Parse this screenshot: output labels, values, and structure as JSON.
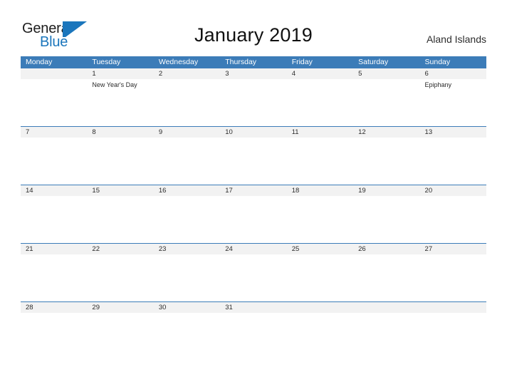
{
  "brand": {
    "name_primary": "General",
    "name_secondary": "Blue",
    "mark_icon": "blue-flag-triangle-icon",
    "primary_color": "#1d1d1d",
    "accent_color": "#1b76bc"
  },
  "header": {
    "title": "January 2019",
    "locale": "Aland Islands"
  },
  "theme": {
    "header_blue": "#3c7cb8",
    "date_strip_gray": "#f2f2f2",
    "text_color": "#2b2b2b",
    "background": "#ffffff"
  },
  "calendar": {
    "month": "January",
    "year": "2019",
    "weekday_headers": [
      "Monday",
      "Tuesday",
      "Wednesday",
      "Thursday",
      "Friday",
      "Saturday",
      "Sunday"
    ],
    "weeks": [
      {
        "days": [
          {
            "num": "",
            "event": ""
          },
          {
            "num": "1",
            "event": "New Year's Day"
          },
          {
            "num": "2",
            "event": ""
          },
          {
            "num": "3",
            "event": ""
          },
          {
            "num": "4",
            "event": ""
          },
          {
            "num": "5",
            "event": ""
          },
          {
            "num": "6",
            "event": "Epiphany"
          }
        ]
      },
      {
        "days": [
          {
            "num": "7",
            "event": ""
          },
          {
            "num": "8",
            "event": ""
          },
          {
            "num": "9",
            "event": ""
          },
          {
            "num": "10",
            "event": ""
          },
          {
            "num": "11",
            "event": ""
          },
          {
            "num": "12",
            "event": ""
          },
          {
            "num": "13",
            "event": ""
          }
        ]
      },
      {
        "days": [
          {
            "num": "14",
            "event": ""
          },
          {
            "num": "15",
            "event": ""
          },
          {
            "num": "16",
            "event": ""
          },
          {
            "num": "17",
            "event": ""
          },
          {
            "num": "18",
            "event": ""
          },
          {
            "num": "19",
            "event": ""
          },
          {
            "num": "20",
            "event": ""
          }
        ]
      },
      {
        "days": [
          {
            "num": "21",
            "event": ""
          },
          {
            "num": "22",
            "event": ""
          },
          {
            "num": "23",
            "event": ""
          },
          {
            "num": "24",
            "event": ""
          },
          {
            "num": "25",
            "event": ""
          },
          {
            "num": "26",
            "event": ""
          },
          {
            "num": "27",
            "event": ""
          }
        ]
      },
      {
        "days": [
          {
            "num": "28",
            "event": ""
          },
          {
            "num": "29",
            "event": ""
          },
          {
            "num": "30",
            "event": ""
          },
          {
            "num": "31",
            "event": ""
          },
          {
            "num": "",
            "event": ""
          },
          {
            "num": "",
            "event": ""
          },
          {
            "num": "",
            "event": ""
          }
        ]
      }
    ]
  }
}
